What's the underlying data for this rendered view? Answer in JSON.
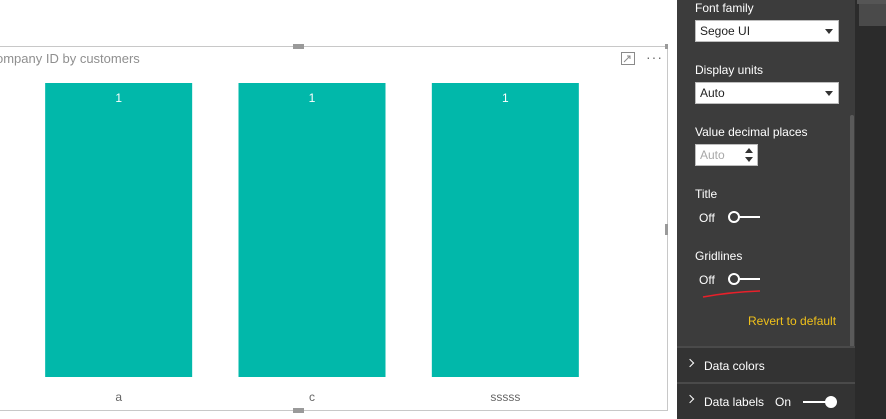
{
  "visual": {
    "title": "ompany ID by customers",
    "icons": [
      "focus-mode-icon",
      "more-options-icon"
    ],
    "more_glyph": "···"
  },
  "chart_data": {
    "type": "bar",
    "categories": [
      "a",
      "c",
      "sssss"
    ],
    "values": [
      1,
      1,
      1
    ],
    "data_labels": [
      "1",
      "1",
      "1"
    ],
    "ylim": [
      0,
      1
    ],
    "grid": false,
    "color": "#01b8aa"
  },
  "format_pane": {
    "font_family": {
      "label": "Font family",
      "value": "Segoe UI"
    },
    "display_units": {
      "label": "Display units",
      "value": "Auto"
    },
    "value_decimal_places": {
      "label": "Value decimal places",
      "value": "Auto"
    },
    "title": {
      "label": "Title",
      "state": "Off"
    },
    "gridlines": {
      "label": "Gridlines",
      "state": "Off"
    },
    "revert": "Revert to default",
    "sections": [
      {
        "title": "Data colors"
      },
      {
        "title": "Data labels",
        "state": "On"
      }
    ],
    "colors": {
      "pane_bg": "#3c3c3c",
      "accent": "#f0c11a",
      "annotation": "#e8202a"
    }
  }
}
